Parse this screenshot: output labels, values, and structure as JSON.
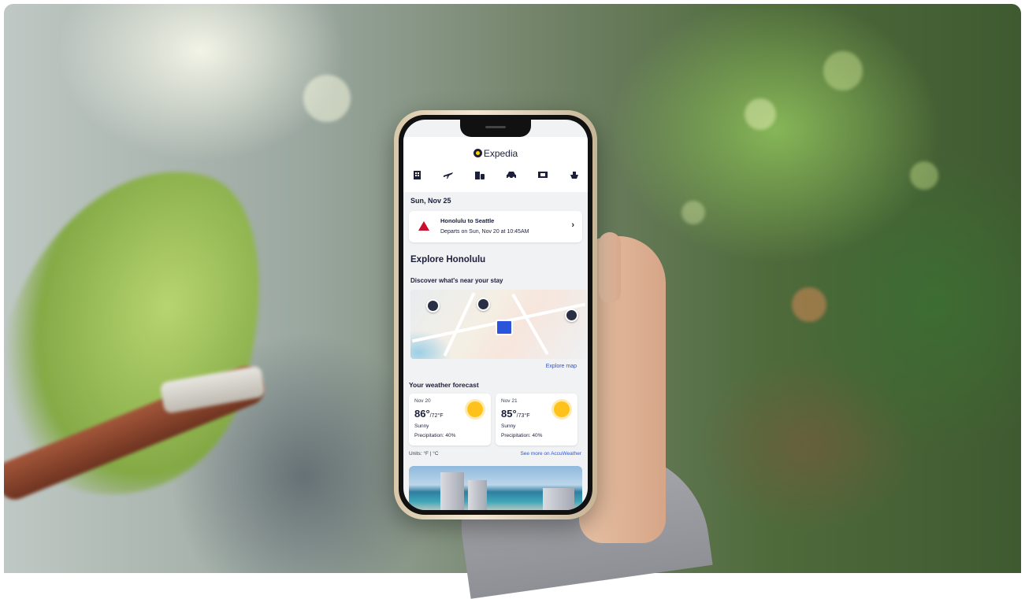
{
  "app": {
    "brand": "Expedia",
    "nav_icons": [
      "hotel-icon",
      "flight-icon",
      "package-icon",
      "car-icon",
      "ticket-icon",
      "cruise-icon"
    ]
  },
  "trip": {
    "date": "Sun, Nov 25",
    "title": "Honolulu to Seattle",
    "subtitle": "Departs on Sun, Nov 20 at 10:45AM"
  },
  "explore": {
    "title": "Explore Honolulu",
    "discover": "Discover what's near your stay",
    "explore_map": "Explore map"
  },
  "weather": {
    "title": "Your weather forecast",
    "cards": [
      {
        "date": "Nov 20",
        "high": "86°",
        "low": "/72°F",
        "condition": "Sunny",
        "precip": "Precipitation: 40%"
      },
      {
        "date": "Nov 21",
        "high": "85°",
        "low": "/73°F",
        "condition": "Sunny",
        "precip": "Precipitation: 40%"
      }
    ],
    "units": "Units: °F | °C",
    "accu": "See more on AccuWeather"
  },
  "colors": {
    "brand_navy": "#1b1f3a",
    "brand_yellow": "#ffd200",
    "link_blue": "#2a55d9",
    "delta_red": "#c8102e"
  }
}
